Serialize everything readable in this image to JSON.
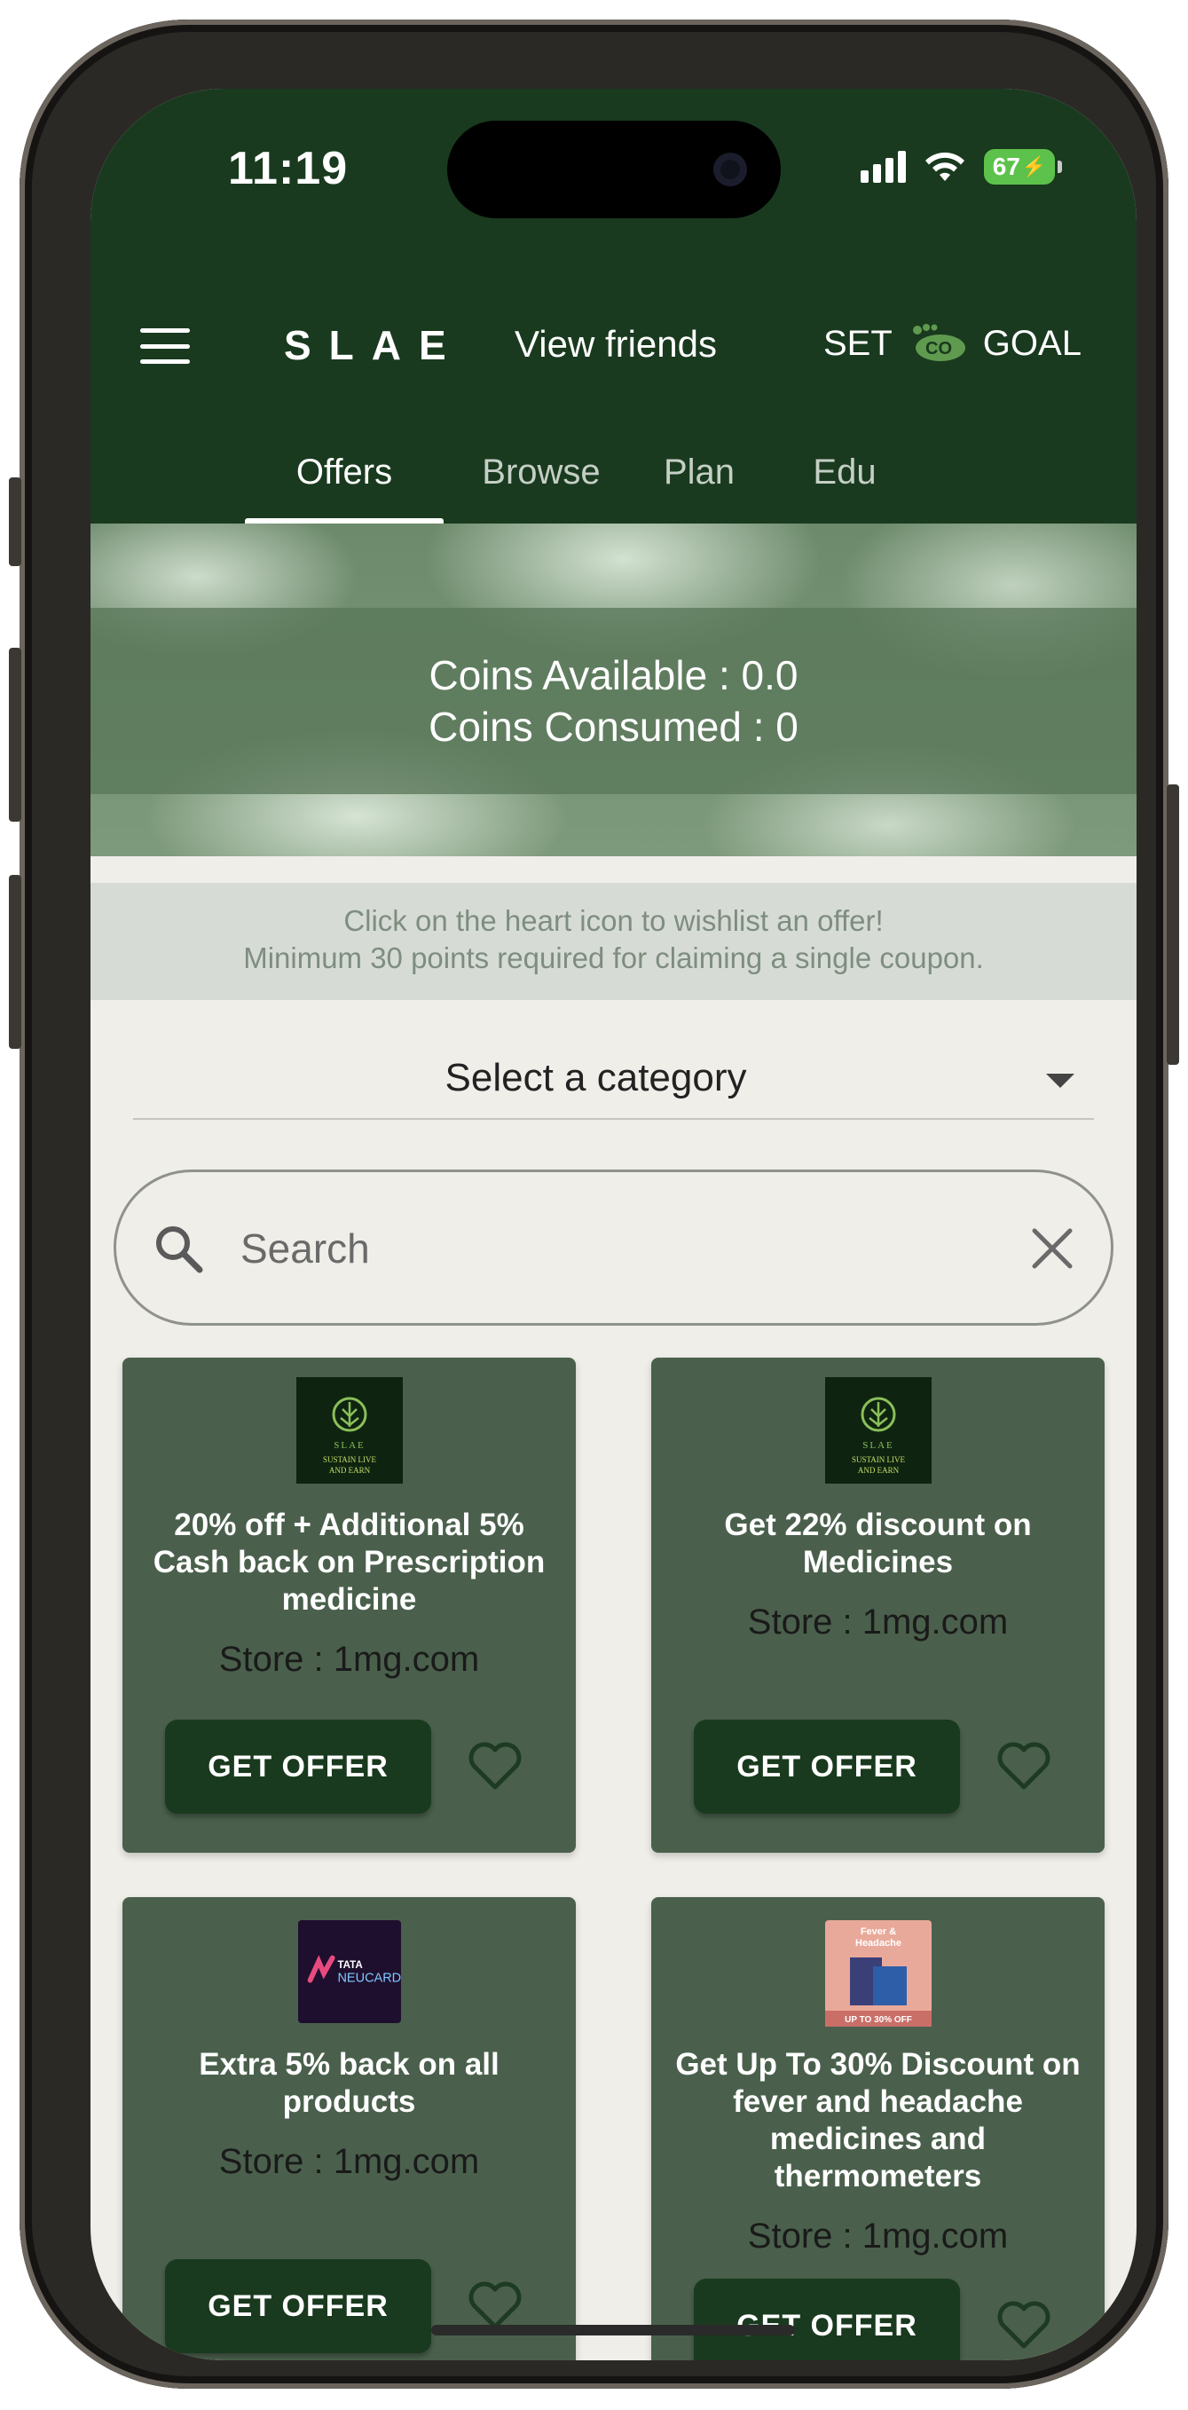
{
  "status_bar": {
    "time": "11:19",
    "battery": "67"
  },
  "appbar": {
    "brand": "SLAE",
    "view_friends": "View friends",
    "set_label": "SET",
    "co2_label": "CO",
    "goal_label": "GOAL"
  },
  "tabs": [
    {
      "label": "Offers",
      "active": true
    },
    {
      "label": "Browse",
      "active": false
    },
    {
      "label": "Plan",
      "active": false
    },
    {
      "label": "Edu",
      "active": false
    }
  ],
  "banner": {
    "coins_available": "Coins Available : 0.0",
    "coins_consumed": "Coins Consumed : 0"
  },
  "info": {
    "line1": "Click on the heart icon to wishlist an offer!",
    "line2": "Minimum 30 points required for claiming a single coupon."
  },
  "category": {
    "label": "Select a category"
  },
  "search": {
    "placeholder": "Search",
    "value": ""
  },
  "offers": [
    {
      "logo": "slae-logo",
      "logo_text": [
        "SLAE",
        "SUSTAIN LIVE",
        "AND EARN"
      ],
      "title": "20% off + Additional 5% Cash back on Prescription medicine",
      "store": "Store : 1mg.com",
      "button": "GET OFFER"
    },
    {
      "logo": "slae-logo",
      "logo_text": [
        "SLAE",
        "SUSTAIN LIVE",
        "AND EARN"
      ],
      "title": "Get 22% discount on Medicines",
      "store": "Store : 1mg.com",
      "button": "GET OFFER"
    },
    {
      "logo": "tata-neucard-logo",
      "logo_text": [
        "TATA",
        "NEUCARD"
      ],
      "title": "Extra 5% back on all products",
      "store": "Store : 1mg.com",
      "button": "GET OFFER"
    },
    {
      "logo": "fever-headache-product-image",
      "logo_text": [
        "Fever &",
        "Headache",
        "UP TO 30% OFF"
      ],
      "title": "Get Up To 30% Discount on fever and headache medicines and thermometers",
      "store": "Store : 1mg.com",
      "button": "GET OFFER"
    }
  ],
  "colors": {
    "header_bg": "#193a1e",
    "card_bg": "#4a604c",
    "page_bg": "#efeee9",
    "button_bg": "#193a1e",
    "battery": "#5dc24b"
  }
}
